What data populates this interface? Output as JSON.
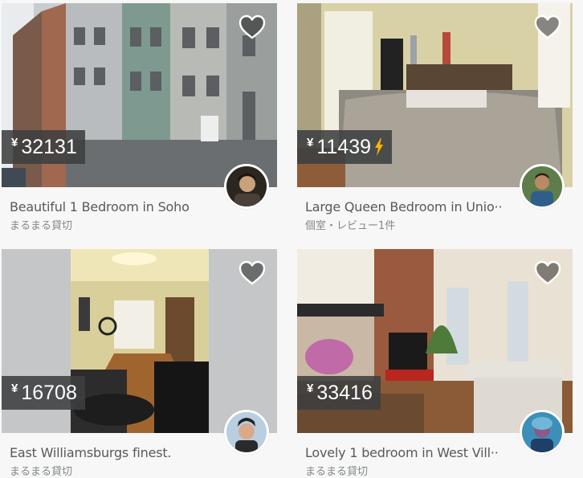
{
  "currency_symbol": "¥",
  "listings": [
    {
      "price": "32131",
      "title": "Beautiful 1 Bedroom in Soho",
      "subtitle": "まるまる貸切",
      "instant_book": false
    },
    {
      "price": "11439",
      "title": "Large Queen Bedroom in Unio··",
      "subtitle": "個室・レビュー1件",
      "instant_book": true
    },
    {
      "price": "16708",
      "title": "East Williamsburgs finest.",
      "subtitle": "まるまる貸切",
      "instant_book": false
    },
    {
      "price": "33416",
      "title": "Lovely 1 bedroom in West Vill··",
      "subtitle": "まるまる貸切",
      "instant_book": false
    }
  ],
  "colors": {
    "price_bg": "#3c3f40",
    "instant_book_bolt": "#ffb400",
    "title_text": "#565a5c",
    "subtitle_text": "#82888a"
  },
  "icons": {
    "wishlist": "heart-icon",
    "instant_book": "lightning-bolt-icon"
  }
}
